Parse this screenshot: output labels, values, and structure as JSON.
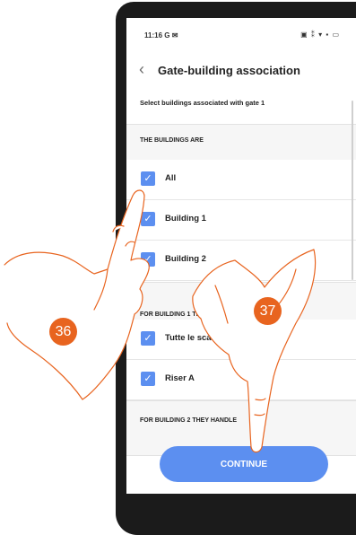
{
  "status": {
    "time": "11:16 G ✉",
    "icons": "▣ ⁑ ▾ ▪ ▭"
  },
  "header": {
    "back_icon": "chevron-left-icon",
    "title": "Gate-building association"
  },
  "subtitle": "Select buildings associated with gate 1",
  "sections": {
    "buildings": "THE BUILDINGS ARE",
    "building1": "FOR BUILDING 1 THEY HANDLE",
    "building2": "FOR BUILDING 2 THEY HANDLE"
  },
  "items": {
    "all": "All",
    "b1": "Building 1",
    "b2": "Building 2",
    "scale": "Tutte le scale",
    "riser": "Riser A"
  },
  "continue_label": "CONTINUE",
  "markers": {
    "m36": "36",
    "m37": "37"
  },
  "colors": {
    "accent": "#5c8ff0",
    "badge": "#e8641f"
  }
}
